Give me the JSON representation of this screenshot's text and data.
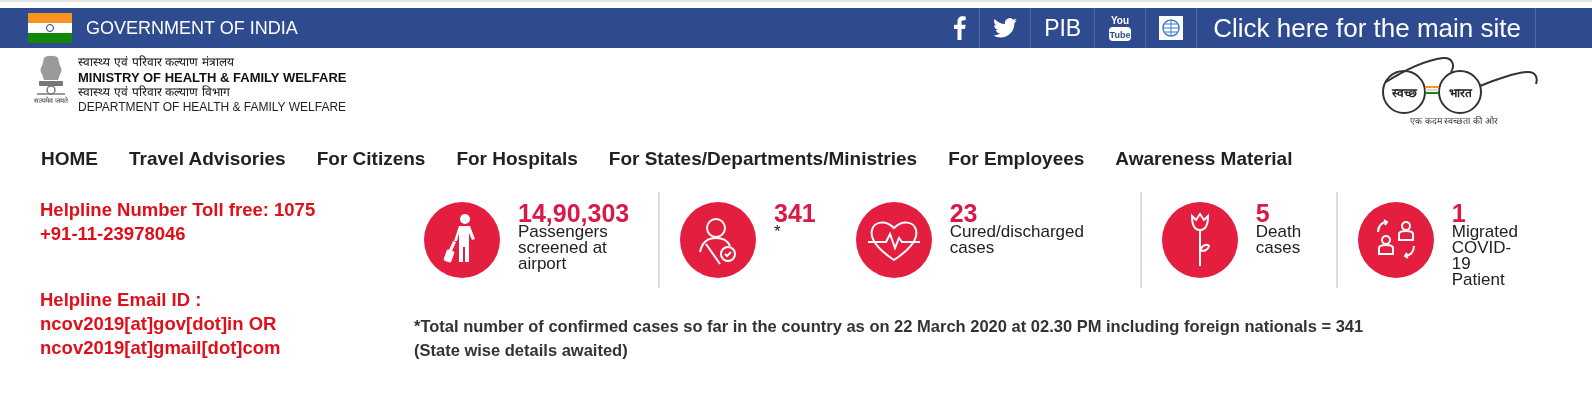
{
  "top_bar": {
    "title": "GOVERNMENT OF INDIA",
    "links": [
      {
        "kind": "facebook"
      },
      {
        "kind": "twitter"
      },
      {
        "kind": "text",
        "label": "PIB"
      },
      {
        "kind": "youtube",
        "lines": [
          "You",
          "Tube"
        ]
      },
      {
        "kind": "who"
      },
      {
        "kind": "text",
        "label": "Click here for the main site"
      }
    ]
  },
  "header": {
    "emblem_motto": "सत्यमेव जयते",
    "lines": [
      {
        "text": "स्वास्थ्य एवं परिवार कल्याण मंत्रालय",
        "kind": "hindi"
      },
      {
        "text": "MINISTRY OF HEALTH & FAMILY WELFARE",
        "kind": "bold"
      },
      {
        "text": "स्वास्थ्य एवं परिवार कल्याण विभाग",
        "kind": "hindi"
      },
      {
        "text": "DEPARTMENT OF HEALTH & FAMILY WELFARE",
        "kind": "plain"
      }
    ],
    "swachh": {
      "left": "स्वच्छ",
      "right": "भारत",
      "tagline": "एक कदम स्वच्छता की ओर"
    }
  },
  "nav": [
    "HOME",
    "Travel Advisories",
    "For Citizens",
    "For Hospitals",
    "For States/Departments/Ministries",
    "For Employees",
    "Awareness Material"
  ],
  "helpline": {
    "phone": [
      "Helpline Number Toll free: 1075",
      "+91-11-23978046"
    ],
    "email": [
      "Helpline Email ID :",
      "ncov2019[at]gov[dot]in OR",
      "ncov2019[at]gmail[dot]com"
    ]
  },
  "stats": [
    {
      "kind": "traveller",
      "value": "14,90,303",
      "label": "Passengers screened at airport"
    },
    {
      "kind": "person-check",
      "value": "341",
      "label": "*"
    },
    {
      "kind": "heart",
      "value": "23",
      "label": "Cured/discharged cases"
    },
    {
      "kind": "rose",
      "value": "5",
      "label": "Death cases"
    },
    {
      "kind": "migrate",
      "value": "1",
      "label": "Migrated COVID-19 Patient"
    }
  ],
  "note": [
    "*Total number of confirmed cases so far in the country as on 22 March 2020 at 02.30 PM including foreign nationals = 341",
    "(State wise details awaited)"
  ]
}
